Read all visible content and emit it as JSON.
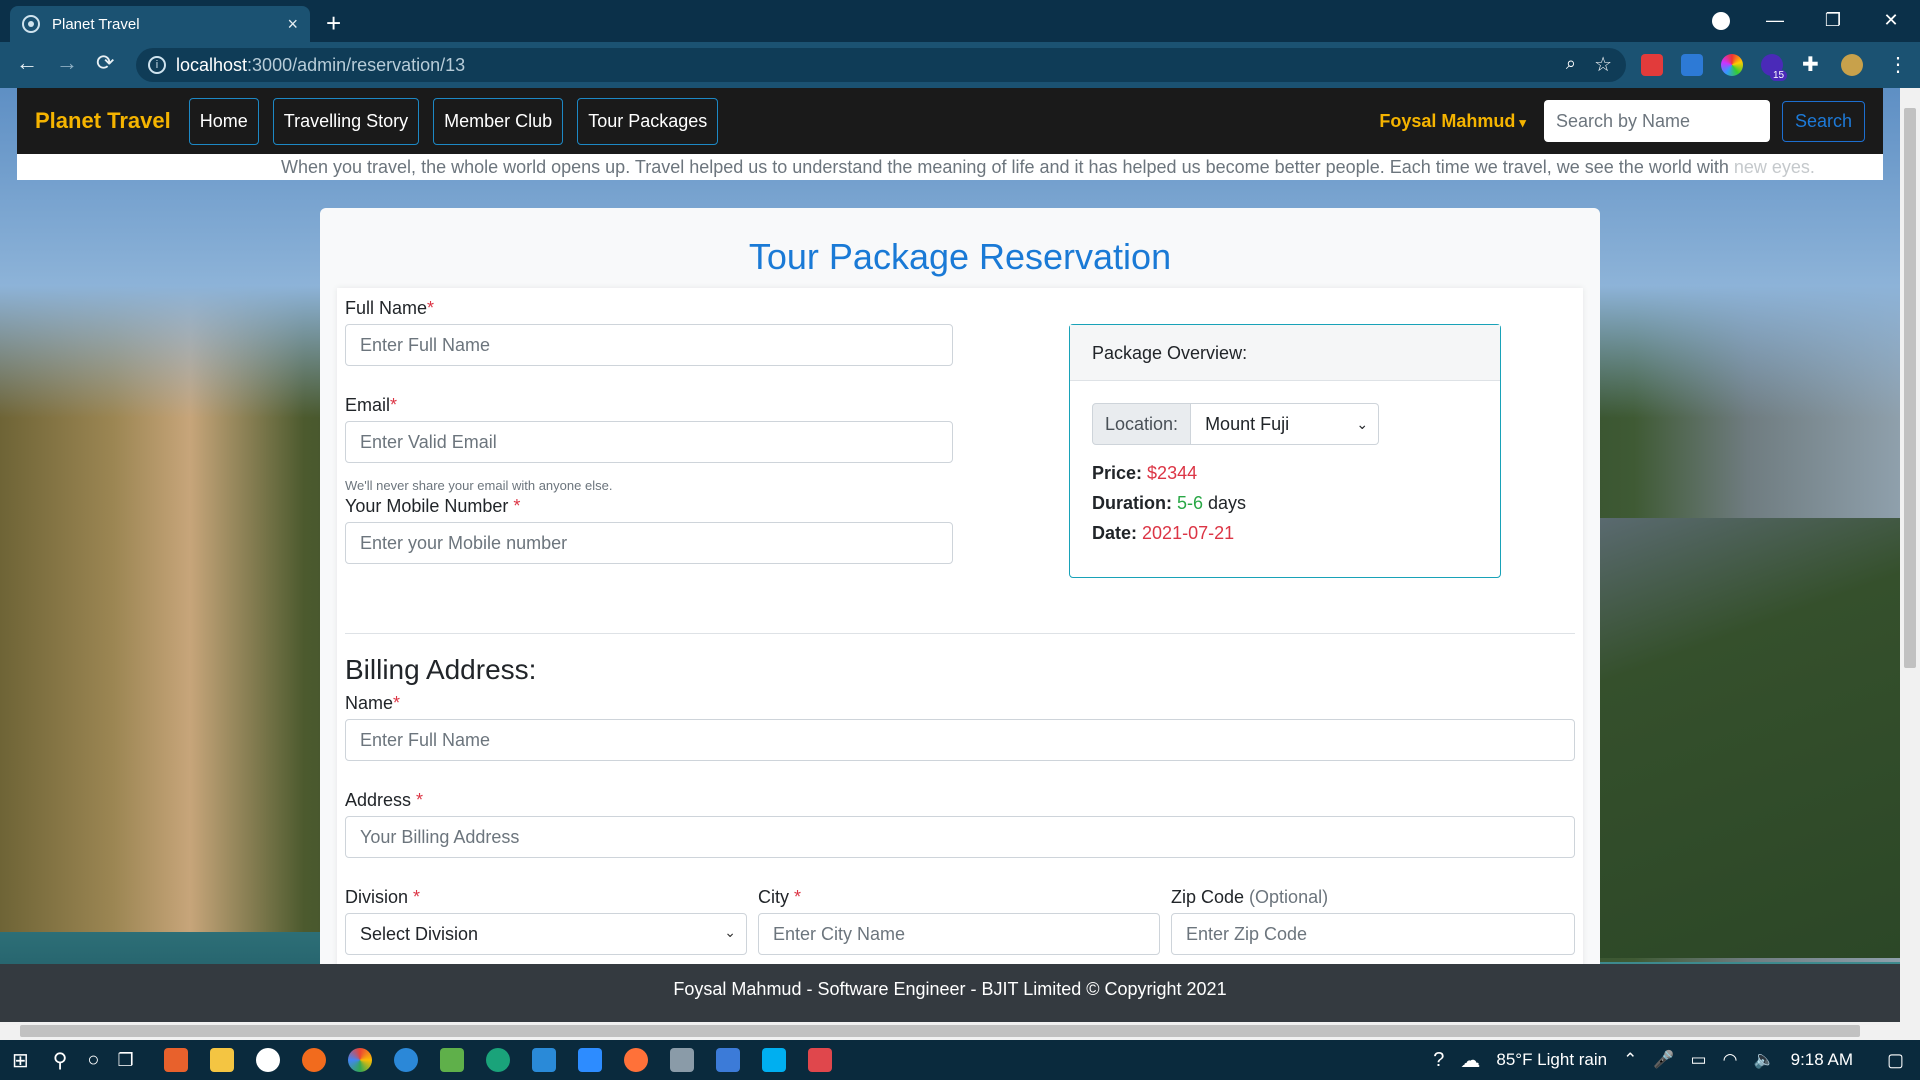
{
  "browser": {
    "tab_title": "Planet Travel",
    "tab_close": "×",
    "new_tab": "+",
    "url_host": "localhost",
    "url_path": ":3000/admin/reservation/13",
    "back": "←",
    "forward": "→",
    "reload": "⟳",
    "minimize": "—",
    "restore": "❐",
    "close": "✕",
    "extension_badge": "15"
  },
  "navbar": {
    "brand": "Planet Travel",
    "links": [
      "Home",
      "Travelling Story",
      "Member Club",
      "Tour Packages"
    ],
    "user": "Foysal Mahmud",
    "search_placeholder": "Search by Name",
    "search_button": "Search"
  },
  "marquee": {
    "text": "When you travel, the whole world opens up. Travel helped us to understand the meaning of life and it has helped us become better people. Each time we travel, we see the world with ",
    "fade_text": "new eyes."
  },
  "page": {
    "title": "Tour Package Reservation"
  },
  "form": {
    "full_name_label": "Full Name",
    "full_name_placeholder": "Enter Full Name",
    "email_label": "Email",
    "email_placeholder": "Enter Valid Email",
    "email_help": "We'll never share your email with anyone else.",
    "mobile_label": "Your Mobile Number ",
    "mobile_placeholder": "Enter your Mobile number",
    "required_mark": "*"
  },
  "overview": {
    "header": "Package Overview:",
    "location_prefix": "Location:",
    "location_value": "Mount Fuji",
    "price_label": "Price:",
    "price_value": "$2344",
    "duration_label": "Duration:",
    "duration_value": "5-6",
    "duration_unit": " days",
    "date_label": "Date:",
    "date_value": "2021-07-21"
  },
  "billing": {
    "title": "Billing Address:",
    "name_label": "Name",
    "name_placeholder": "Enter Full Name",
    "address_label": "Address ",
    "address_placeholder": "Your Billing Address",
    "division_label": "Division ",
    "division_value": "Select Division",
    "city_label": "City ",
    "city_placeholder": "Enter City Name",
    "zip_label": "Zip Code ",
    "zip_optional": "(Optional)",
    "zip_placeholder": "Enter Zip Code"
  },
  "footer": {
    "text": "Foysal Mahmud - Software Engineer - BJIT Limited © Copyright 2021"
  },
  "taskbar": {
    "weather": "85°F  Light rain",
    "time": "9:18 AM"
  },
  "colors": {
    "brand": "#f5b400",
    "title_blue": "#1a7ad6",
    "required_red": "#dc3545",
    "duration_green": "#28a745",
    "overview_border": "#18a2b8"
  }
}
